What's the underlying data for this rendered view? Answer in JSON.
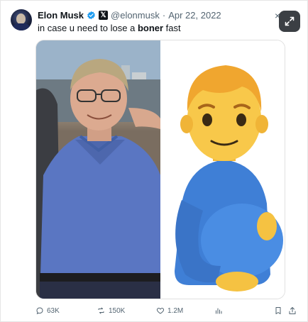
{
  "tweet": {
    "display_name": "Elon Musk",
    "handle": "@elonmusk",
    "separator": "·",
    "date": "Apr 22, 2022",
    "text_before": "in case u need to lose a ",
    "text_bold": "boner",
    "text_after": " fast",
    "close_glyph": "×"
  },
  "actions": {
    "replies": "63K",
    "reposts": "150K",
    "likes": "1.2M"
  },
  "icons": {
    "verified": "verified-badge-icon",
    "x_logo": "x-logo-icon",
    "expand": "expand-icon",
    "reply": "reply-icon",
    "repost": "repost-icon",
    "like": "heart-icon",
    "views": "views-icon",
    "bookmark": "bookmark-icon",
    "share": "share-icon"
  },
  "colors": {
    "verified_blue": "#1d9bf0",
    "muted_text": "#536471",
    "expand_button_bg": "#3b3f44"
  }
}
